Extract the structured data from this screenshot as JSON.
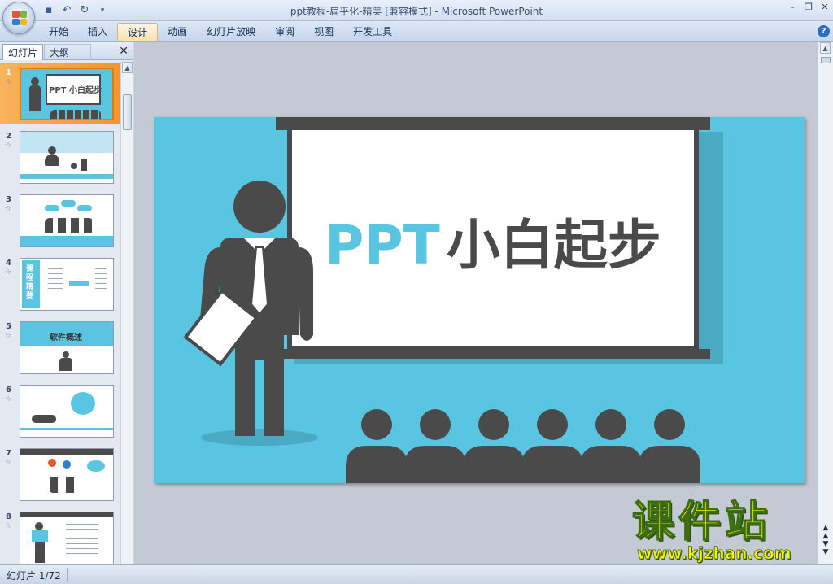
{
  "window": {
    "title": "ppt教程-扁平化-精美 [兼容模式] - Microsoft PowerPoint",
    "controls": [
      "minimize-icon",
      "restore-icon",
      "close-icon"
    ]
  },
  "quick_access": [
    "save-icon",
    "undo-icon",
    "redo-icon",
    "customize-icon"
  ],
  "ribbon": {
    "tabs": [
      "开始",
      "插入",
      "设计",
      "动画",
      "幻灯片放映",
      "审阅",
      "视图",
      "开发工具"
    ],
    "active_tab": "设计"
  },
  "panel": {
    "tab_slides": "幻灯片",
    "tab_outline": "大纲",
    "selected_slide": 1,
    "thumbnails": [
      {
        "num": "1",
        "star": "☆",
        "text": "PPT 小白起步"
      },
      {
        "num": "2",
        "star": "☆",
        "text": ""
      },
      {
        "num": "3",
        "star": "☆",
        "text": ""
      },
      {
        "num": "4",
        "star": "☆",
        "text": "课程 精要"
      },
      {
        "num": "5",
        "star": "☆",
        "text": "软件概述"
      },
      {
        "num": "6",
        "star": "☆",
        "text": ""
      },
      {
        "num": "7",
        "star": "☆",
        "text": ""
      },
      {
        "num": "8",
        "star": "☆",
        "text": ""
      }
    ]
  },
  "slide": {
    "title_part1": "PPT",
    "title_part2": "小白起步",
    "background_color": "#5ac5e0",
    "figure_color": "#4a4a4a",
    "board_color": "#ffffff"
  },
  "status": {
    "slide_indicator": "幻灯片 1/72"
  },
  "watermark": {
    "brand": "课件站",
    "url": "www.kjzhan.com",
    "color": "#ffef00"
  },
  "colors": {
    "accent": "#f4952f",
    "ribbon": "#c7d6ec"
  }
}
